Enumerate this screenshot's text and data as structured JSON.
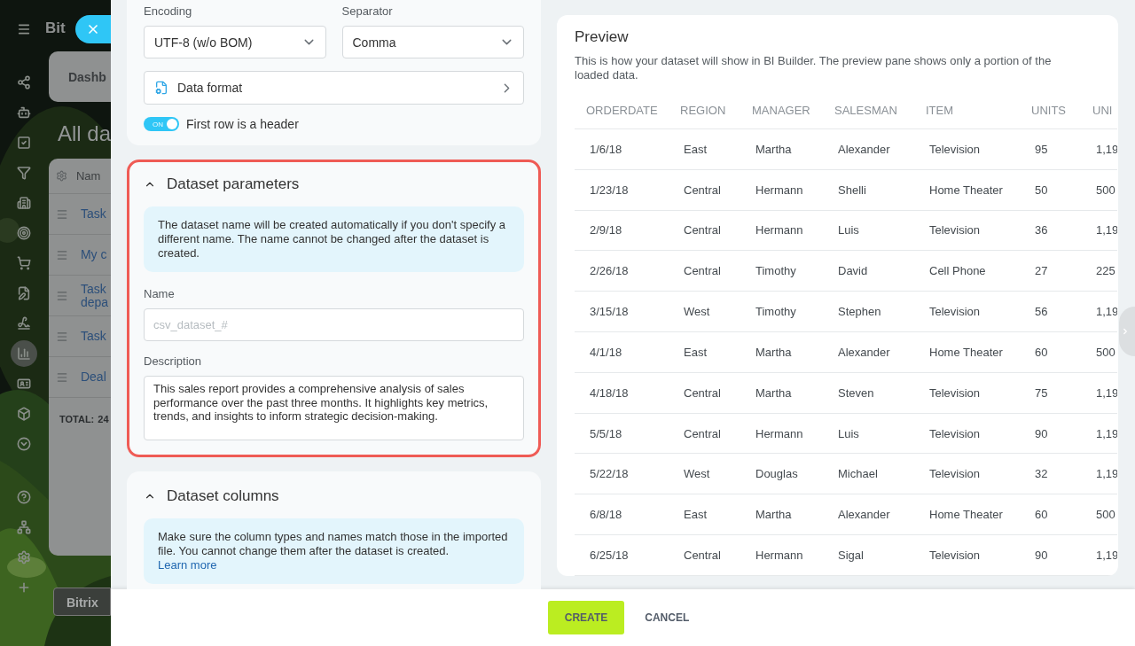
{
  "background": {
    "sidebar_items": [
      {
        "selected": false
      },
      {
        "selected": false
      },
      {
        "selected": false
      },
      {
        "selected": false
      },
      {
        "selected": false
      },
      {
        "selected": false
      },
      {
        "selected": false
      },
      {
        "selected": false
      },
      {
        "selected": false
      },
      {
        "selected": false
      },
      {
        "selected": true
      },
      {
        "selected": false
      },
      {
        "selected": false
      },
      {
        "selected": false
      },
      {
        "selected": false
      },
      {
        "selected": false
      },
      {
        "selected": false
      },
      {
        "selected": false
      }
    ],
    "logo": "Bit",
    "tab": "Dashb",
    "heading": "All da",
    "table_header": "Nam",
    "rows": [
      {
        "lines": [
          "Task"
        ]
      },
      {
        "lines": [
          "My c"
        ]
      },
      {
        "lines": [
          "Task",
          "depa"
        ]
      },
      {
        "lines": [
          "Task"
        ]
      },
      {
        "lines": [
          "Deal"
        ]
      }
    ],
    "total_label": "TOTAL:",
    "total_value": "24",
    "footer_button": "Bitrix"
  },
  "file_settings": {
    "encoding": {
      "label": "Encoding",
      "value": "UTF-8 (w/o BOM)"
    },
    "separator": {
      "label": "Separator",
      "value": "Comma"
    },
    "data_format": "Data format",
    "header_toggle": {
      "label": "First row is a header",
      "switch_text": "ON",
      "on": true
    }
  },
  "dataset_parameters": {
    "title": "Dataset parameters",
    "expanded": true,
    "info": "The dataset name will be created automatically if you don't specify a different name. The name cannot be changed after the dataset is created.",
    "name": {
      "label": "Name",
      "placeholder": "csv_dataset_#"
    },
    "description": {
      "label": "Description",
      "value": "This sales report provides a comprehensive analysis of sales performance over the past three months. It highlights key metrics, trends, and insights to inform strategic decision-making."
    }
  },
  "dataset_columns": {
    "title": "Dataset columns",
    "expanded": true,
    "info": "Make sure the column types and names match those in the imported file. You cannot change them after the dataset is created.",
    "link": "Learn more"
  },
  "preview": {
    "title": "Preview",
    "description": "This is how your dataset will show in BI Builder. The preview pane shows only a portion of the loaded data.",
    "columns": [
      "ORDERDATE",
      "REGION",
      "MANAGER",
      "SALESMAN",
      "ITEM",
      "UNITS",
      "UNI"
    ],
    "rows": [
      [
        "1/6/18",
        "East",
        "Martha",
        "Alexander",
        "Television",
        "95",
        "1,19"
      ],
      [
        "1/23/18",
        "Central",
        "Hermann",
        "Shelli",
        "Home Theater",
        "50",
        "500"
      ],
      [
        "2/9/18",
        "Central",
        "Hermann",
        "Luis",
        "Television",
        "36",
        "1,19"
      ],
      [
        "2/26/18",
        "Central",
        "Timothy",
        "David",
        "Cell Phone",
        "27",
        "225"
      ],
      [
        "3/15/18",
        "West",
        "Timothy",
        "Stephen",
        "Television",
        "56",
        "1,19"
      ],
      [
        "4/1/18",
        "East",
        "Martha",
        "Alexander",
        "Home Theater",
        "60",
        "500"
      ],
      [
        "4/18/18",
        "Central",
        "Martha",
        "Steven",
        "Television",
        "75",
        "1,19"
      ],
      [
        "5/5/18",
        "Central",
        "Hermann",
        "Luis",
        "Television",
        "90",
        "1,19"
      ],
      [
        "5/22/18",
        "West",
        "Douglas",
        "Michael",
        "Television",
        "32",
        "1,19"
      ],
      [
        "6/8/18",
        "East",
        "Martha",
        "Alexander",
        "Home Theater",
        "60",
        "500"
      ],
      [
        "6/25/18",
        "Central",
        "Hermann",
        "Sigal",
        "Television",
        "90",
        "1,19"
      ]
    ]
  },
  "footer": {
    "create": "CREATE",
    "cancel": "CANCEL"
  }
}
